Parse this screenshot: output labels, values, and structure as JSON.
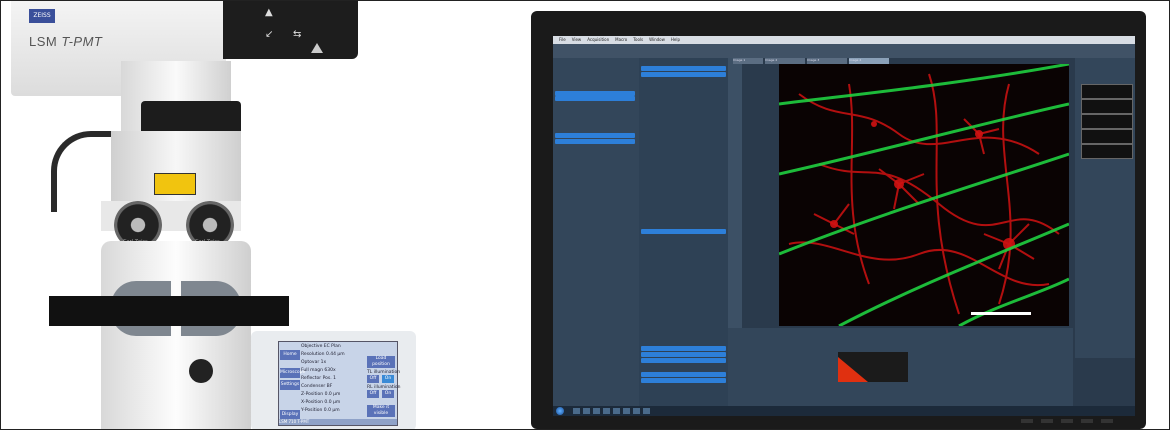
{
  "microscope": {
    "brand": "ZEISS",
    "model": "LSM",
    "model_suffix": "T-PMT",
    "eyepiece_text": "Carl Zeiss",
    "panel": {
      "home": "Home",
      "microscope": "Microscope",
      "settings": "Settings",
      "display": "Display",
      "load_position": "Load position",
      "illumination": "TL illumination",
      "off": "Off",
      "on": "On",
      "rl_illumination": "RL illumination",
      "make_it_visible": "Make it visible",
      "rows": [
        "Objective  EC Plan",
        "Resolution  0.44 µm",
        "Optovar  1x",
        "Full magn  630x",
        "Reflector  Pos. 1",
        "Condenser  BF",
        "Z-Position  0.0 µm",
        "X-Position  0.0 µm",
        "Y-Position  0.0 µm"
      ],
      "footer": "LSM 710 T-PMT"
    }
  },
  "software": {
    "menu": [
      "File",
      "View",
      "Acquisition",
      "Macro",
      "Tools",
      "Window",
      "Help"
    ],
    "tabs": [
      "Image 1",
      "Image 2",
      "Image 3",
      "Image 4"
    ],
    "colors": {
      "red_channel": "#e01010",
      "green_channel": "#20d040",
      "ui_blue": "#2d7fd9"
    }
  }
}
